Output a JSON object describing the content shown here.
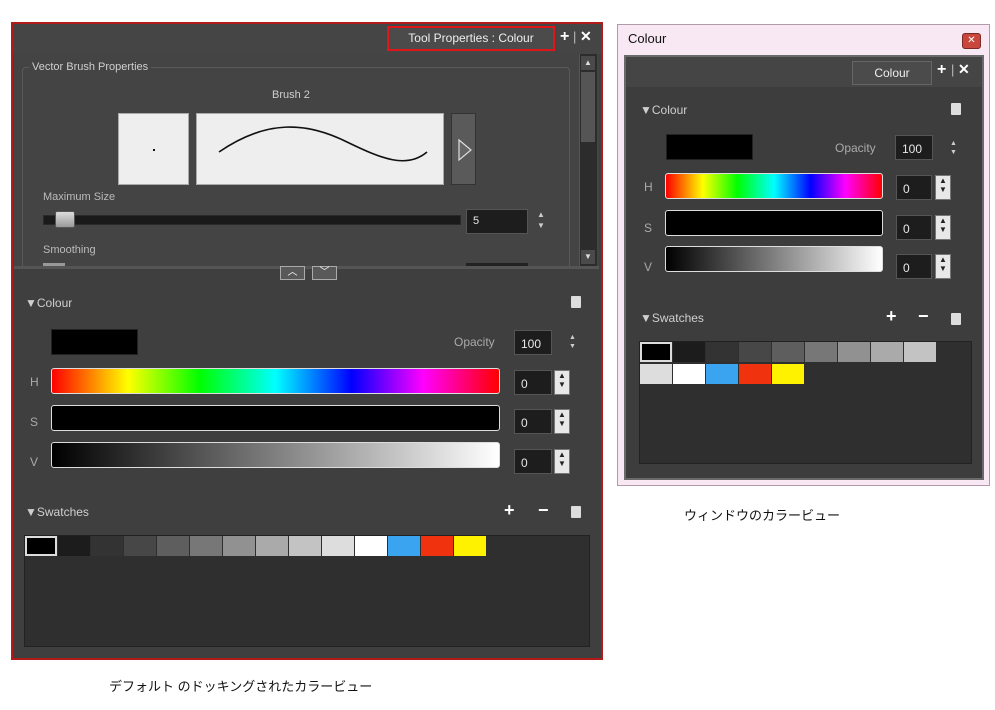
{
  "docked": {
    "tab_title": "Tool Properties : Colour",
    "section_title": "Vector Brush Properties",
    "brush_name": "Brush 2",
    "max_size_label": "Maximum Size",
    "max_size_value": "5",
    "smoothing_label": "Smoothing",
    "colour_section": "Colour",
    "opacity_label": "Opacity",
    "opacity_value": "100",
    "h_label": "H",
    "s_label": "S",
    "v_label": "V",
    "h_value": "0",
    "s_value": "0",
    "v_value": "0",
    "swatches_label": "Swatches",
    "caption": "デフォルト のドッキングされたカラービュー"
  },
  "floating": {
    "window_title": "Colour",
    "tab_label": "Colour",
    "colour_section": "Colour",
    "opacity_label": "Opacity",
    "opacity_value": "100",
    "h_label": "H",
    "s_label": "S",
    "v_label": "V",
    "h_value": "0",
    "s_value": "0",
    "v_value": "0",
    "swatches_label": "Swatches",
    "caption": "ウィンドウのカラービュー"
  },
  "swatch_colors": [
    "#000000",
    "#1c1c1c",
    "#333333",
    "#474747",
    "#5e5e5e",
    "#777777",
    "#919191",
    "#aaaaaa",
    "#c3c3c3",
    "#dddddd",
    "#ffffff",
    "#3aa4f0",
    "#f0320e",
    "#fff200"
  ],
  "selected_swatch_color": "#000000",
  "highlight_color": "#cc1111"
}
